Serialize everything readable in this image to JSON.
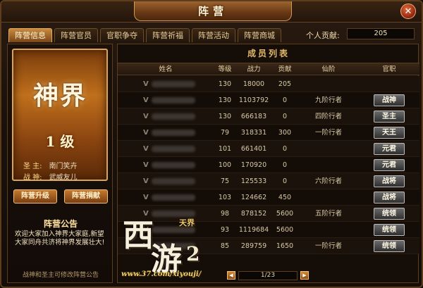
{
  "window": {
    "title": "阵营",
    "close_label": "✕"
  },
  "tabs": [
    {
      "label": "阵营信息",
      "active": true
    },
    {
      "label": "阵营官员",
      "active": false
    },
    {
      "label": "官职争夺",
      "active": false
    },
    {
      "label": "阵营祈福",
      "active": false
    },
    {
      "label": "阵营活动",
      "active": false
    },
    {
      "label": "阵营商城",
      "active": false
    }
  ],
  "contribution": {
    "label": "个人贡献:",
    "value": "205"
  },
  "faction": {
    "name": "神界",
    "level": "1 级",
    "leader_label": "圣 主:",
    "leader_name": "南门笑卉",
    "war_god_label": "战 神:",
    "war_god_name": "武威友儿",
    "upgrade_button": "阵营升级",
    "donate_button": "阵营捐献",
    "announcement_title": "阵营公告",
    "announcement_text": "欢迎大家加入神界大家庭,新望大家同舟共济将神界发展壮大!",
    "footer_note": "战神和圣主可修改阵营公告"
  },
  "member_list": {
    "title": "成员列表",
    "columns": [
      "姓名",
      "等级",
      "战力",
      "贡献",
      "仙阶",
      "官职"
    ],
    "rows": [
      {
        "vip": "V",
        "level": "130",
        "power": "18000",
        "contribution": "205",
        "rank": "",
        "position": ""
      },
      {
        "vip": "V",
        "level": "130",
        "power": "1103792",
        "contribution": "0",
        "rank": "九阶行者",
        "position": "战神"
      },
      {
        "vip": "V",
        "level": "130",
        "power": "666183",
        "contribution": "0",
        "rank": "四阶行者",
        "position": "圣主"
      },
      {
        "vip": "V",
        "level": "79",
        "power": "318331",
        "contribution": "300",
        "rank": "一阶行者",
        "position": "天王"
      },
      {
        "vip": "V",
        "level": "101",
        "power": "661401",
        "contribution": "0",
        "rank": "",
        "position": "元君"
      },
      {
        "vip": "V",
        "level": "100",
        "power": "170920",
        "contribution": "0",
        "rank": "",
        "position": "元君"
      },
      {
        "vip": "V",
        "level": "75",
        "power": "125533",
        "contribution": "0",
        "rank": "六阶行者",
        "position": "战将"
      },
      {
        "vip": "V",
        "level": "103",
        "power": "124662",
        "contribution": "450",
        "rank": "",
        "position": "战将"
      },
      {
        "vip": "V",
        "level": "98",
        "power": "878152",
        "contribution": "5600",
        "rank": "五阶行者",
        "position": "统领"
      },
      {
        "vip": "V",
        "level": "93",
        "power": "1119684",
        "contribution": "5600",
        "rank": "",
        "position": "统领"
      },
      {
        "vip": "V",
        "level": "85",
        "power": "289759",
        "contribution": "1650",
        "rank": "一阶行者",
        "position": "统领"
      }
    ]
  },
  "pagination": {
    "text": "1/23",
    "prev": "◀",
    "next": "▶"
  },
  "watermark": {
    "logo_glyph_1": "西",
    "logo_glyph_2": "游",
    "logo_number": "2",
    "logo_small": "天界",
    "url": "www.37.com/xiyouji/"
  },
  "colors": {
    "accent": "#c98a3e",
    "gold": "#f1d36c",
    "button_gray": "#4a4a4a"
  }
}
